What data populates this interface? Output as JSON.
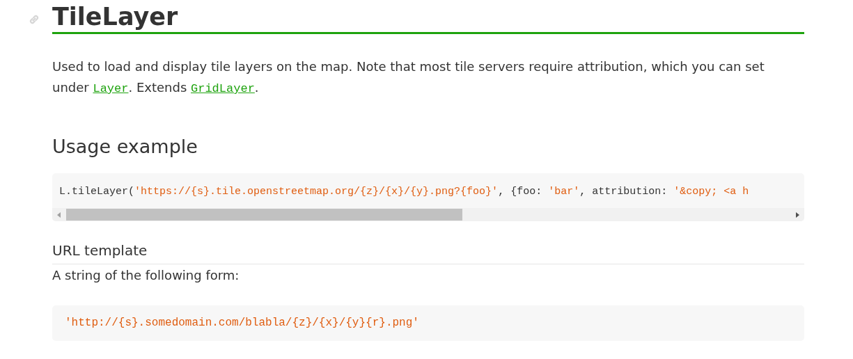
{
  "title": "TileLayer",
  "intro": {
    "text": "Used to load and display tile layers on the map. Note that most tile servers require attribution, which you can set under ",
    "links": [
      {
        "label": "Layer",
        "after": ". Extends "
      },
      {
        "label": "GridLayer",
        "after": "."
      }
    ]
  },
  "usage_heading": "Usage example",
  "usage_code": [
    {
      "kind": "plain",
      "text": "L.tileLayer("
    },
    {
      "kind": "string",
      "text": "'https://{s}.tile.openstreetmap.org/{z}/{x}/{y}.png?{foo}'"
    },
    {
      "kind": "plain",
      "text": ", {foo: "
    },
    {
      "kind": "string",
      "text": "'bar'"
    },
    {
      "kind": "plain",
      "text": ", attribution: "
    },
    {
      "kind": "string",
      "text": "'&copy; <a h"
    }
  ],
  "url_heading": "URL template",
  "url_text": "A string of the following form:",
  "url_code": [
    {
      "kind": "string",
      "text": "'http://{s}.somedomain.com/blabla/{z}/{x}/{y}{r}.png'"
    }
  ]
}
